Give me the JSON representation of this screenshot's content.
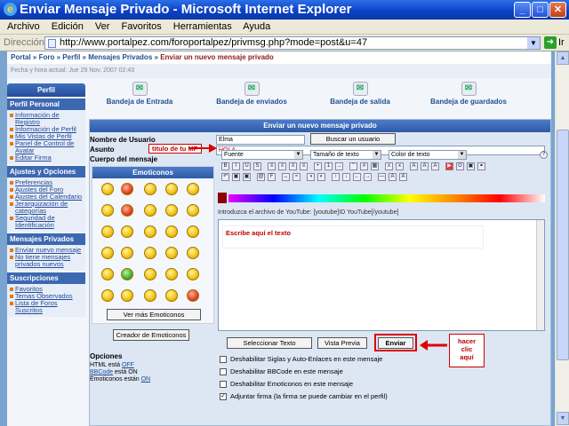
{
  "window": {
    "title": "Enviar Mensaje Privado - Microsoft Internet Explorer",
    "logo": "e",
    "minimize": "_",
    "maximize": "□",
    "close": "✕"
  },
  "menu": [
    "Archivo",
    "Edición",
    "Ver",
    "Favoritos",
    "Herramientas",
    "Ayuda"
  ],
  "address": {
    "label": "Dirección",
    "url": "http://www.portalpez.com/foroportalpez/privmsg.php?mode=post&u=47",
    "go": "Ir"
  },
  "breadcrumb": {
    "items": [
      "Portal",
      "Foro",
      "Perfil",
      "Mensajes Privados"
    ],
    "separator": "»",
    "current": "Enviar un nuevo mensaje privado"
  },
  "date": "Fecha y hora actual: Jue 29 Nov, 2007 02:43",
  "sidebar": {
    "title": "Perfil",
    "sections": [
      {
        "title": "Perfil Personal",
        "links": [
          "Información de Registro",
          "Información de Perfil",
          "Mis Vistas de Perfil",
          "Panel de Control de Avatar",
          "Editar Firma"
        ]
      },
      {
        "title": "Ajustes y Opciones",
        "links": [
          "Preferencias",
          "Ajustes del Foro",
          "Ajustes del Calendario",
          "Jerarquización de categorías",
          "Seguridad de Identificación"
        ]
      },
      {
        "title": "Mensajes Privados",
        "links": [
          "Enviar nuevo mensaje",
          "No tiene mensajes privados nuevos"
        ]
      },
      {
        "title": "Suscripciones",
        "links": [
          "Favoritos",
          "Temas Observados",
          "Lista de Foros Suscritos"
        ]
      }
    ]
  },
  "mailbox": {
    "inbox": "Bandeja de Entrada",
    "sent": "Bandeja de enviados",
    "outbox": "Bandeja de salida",
    "saved": "Bandeja de guardados"
  },
  "form": {
    "header": "Enviar un nuevo mensaje privado",
    "username_label": "Nombre de Usuario",
    "username_value": "Elma",
    "find_user": "Buscar un usuario",
    "subject_label": "Asunto",
    "subject_value": "HOLA",
    "body_label": "Cuerpo del mensaje",
    "font_select": "Fuente",
    "size_select": "Tamaño de texto",
    "color_select": "Color de texto",
    "youtube_hint": "Introduzca el archivo de YouTube: [youtube]ID YouTube[/youtube]",
    "emoticons": {
      "title": "Emoticonos",
      "more": "Ver más Emoticonos",
      "creator": "Creador de Emoticonos"
    },
    "buttons": {
      "select_text": "Seleccionar Texto",
      "preview": "Vista Previa",
      "send": "Enviar"
    },
    "options": {
      "title": "Opciones",
      "html": {
        "label": "HTML está",
        "value": "OFF"
      },
      "bbcode": {
        "label": "BBCode",
        "value": "está ON"
      },
      "emoticons": {
        "label": "Emoticonos están",
        "value": "ON"
      },
      "checkboxes": [
        {
          "label": "Deshabilitar Siglas y Auto-Enlaces en este mensaje",
          "checked": false
        },
        {
          "label": "Deshabilitar BBCode en este mensaje",
          "checked": false
        },
        {
          "label": "Deshabilitar Emoticonos en este mensaje",
          "checked": false
        },
        {
          "label": "Adjuntar firma (la firma se puede cambiar en el perfil)",
          "checked": true
        }
      ]
    }
  },
  "annotations": {
    "subject": "titulo de tu MP",
    "body": "Escribe aquí el texto",
    "send": [
      "hacer",
      "clic",
      "aquí"
    ]
  },
  "colors": {
    "titlebar": "#0a3fc4",
    "annotation": "#c00000",
    "panel": "#3c68b1"
  }
}
